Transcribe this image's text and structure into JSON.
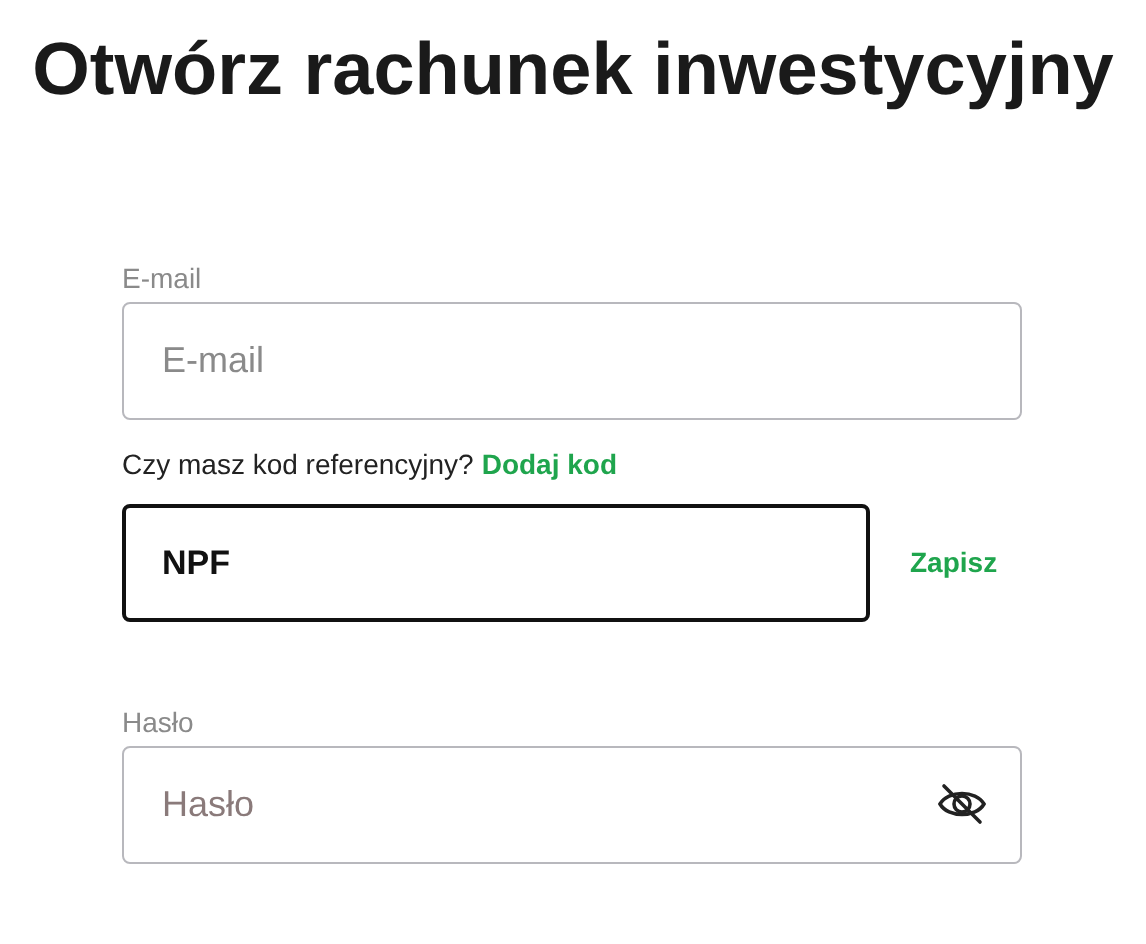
{
  "title": "Otwórz rachunek inwestycyjny",
  "email": {
    "label": "E-mail",
    "placeholder": "E-mail"
  },
  "referral": {
    "question": "Czy masz kod referencyjny?",
    "link": "Dodaj kod",
    "value": "NPF",
    "action": "Zapisz"
  },
  "password": {
    "label": "Hasło",
    "placeholder": "Hasło"
  }
}
